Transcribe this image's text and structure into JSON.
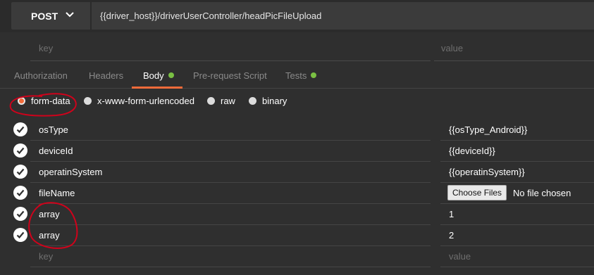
{
  "request": {
    "method": "POST",
    "url": "{{driver_host}}/driverUserController/headPicFileUpload"
  },
  "params": {
    "key_placeholder": "key",
    "value_placeholder": "value"
  },
  "tabs": [
    {
      "label": "Authorization",
      "active": false,
      "dot": false
    },
    {
      "label": "Headers",
      "active": false,
      "dot": false
    },
    {
      "label": "Body",
      "active": true,
      "dot": true
    },
    {
      "label": "Pre-request Script",
      "active": false,
      "dot": false
    },
    {
      "label": "Tests",
      "active": false,
      "dot": true
    }
  ],
  "body_modes": [
    {
      "label": "form-data",
      "selected": true
    },
    {
      "label": "x-www-form-urlencoded",
      "selected": false
    },
    {
      "label": "raw",
      "selected": false
    },
    {
      "label": "binary",
      "selected": false
    }
  ],
  "form_rows": [
    {
      "key": "osType",
      "value": "{{osType_Android}}",
      "checked": true
    },
    {
      "key": "deviceId",
      "value": "{{deviceId}}",
      "checked": true
    },
    {
      "key": "operatinSystem",
      "value": "{{operatinSystem}}",
      "checked": true
    },
    {
      "key": "fileName",
      "file_button": "Choose Files",
      "file_status": "No file chosen",
      "checked": true
    },
    {
      "key": "array",
      "value": "1",
      "checked": true
    },
    {
      "key": "array",
      "value": "2",
      "checked": true
    }
  ],
  "new_row": {
    "key_placeholder": "key",
    "value_placeholder": "value"
  },
  "colors": {
    "accent": "#f26b3a",
    "status_dot": "#7ac043",
    "annotation": "#d0021b"
  },
  "icons": {
    "method_dropdown": "chevron-down-icon",
    "checkbox": "check-icon"
  }
}
